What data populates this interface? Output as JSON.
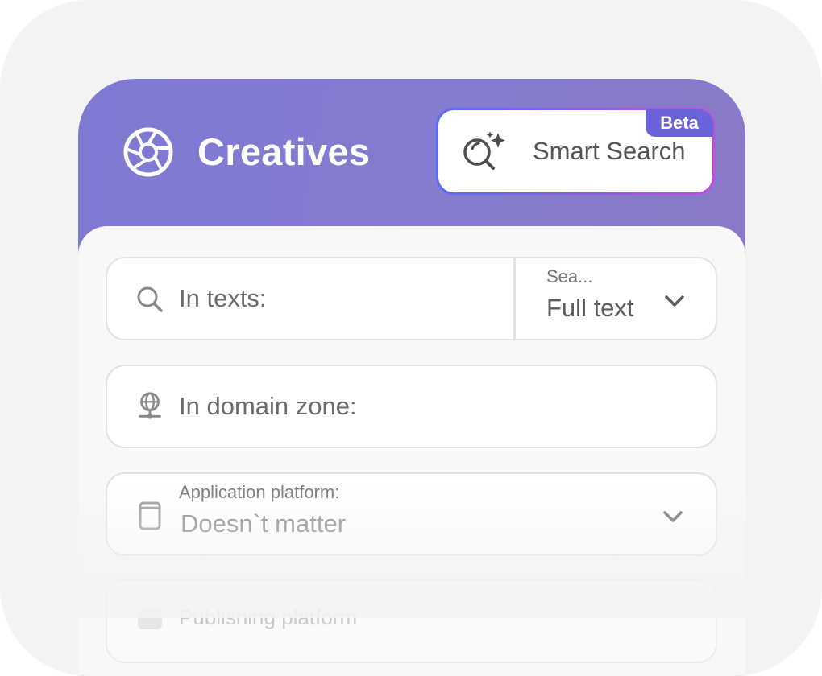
{
  "header": {
    "title": "Creatives",
    "logo_icon": "aperture-icon",
    "gradient_colors": [
      "#7e79d3",
      "#8b78c4"
    ]
  },
  "smart_search": {
    "label": "Smart Search",
    "badge": "Beta",
    "icon": "sparkle-search-icon",
    "border_colors": [
      "#5b6cf0",
      "#c34be0"
    ],
    "badge_color": "#6b63d9"
  },
  "filters": {
    "text_search": {
      "label": "In texts:",
      "icon": "search-icon",
      "mode_label": "Sea...",
      "mode_value": "Full text"
    },
    "domain_zone": {
      "label": "In domain zone:",
      "icon": "globe-icon"
    },
    "application_platform": {
      "label": "Application platform:",
      "value": "Doesn`t matter",
      "icon": "phone-icon"
    },
    "publishing_platform": {
      "label": "Publishing platform"
    }
  }
}
